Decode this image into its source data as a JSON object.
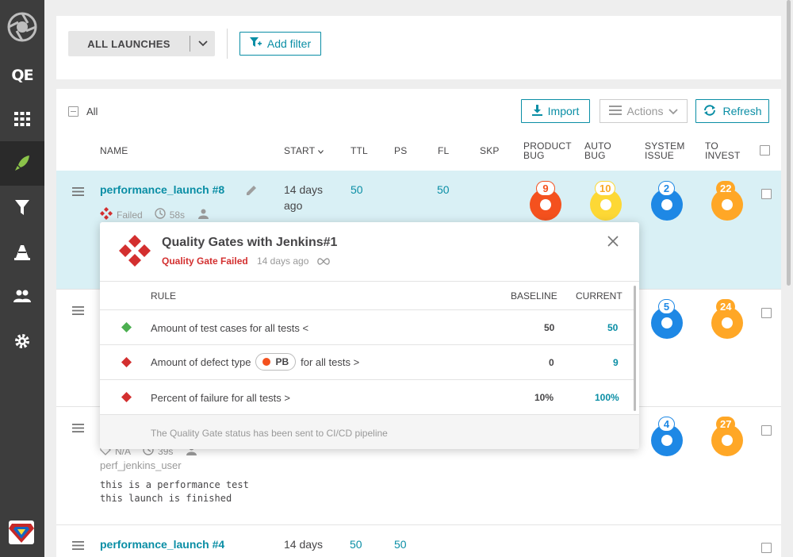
{
  "sidebar": {
    "logo": "aperture-logo-icon",
    "project_label": "QE",
    "items": [
      "dashboard-icon",
      "launches-icon",
      "filters-icon",
      "debug-icon",
      "members-icon",
      "settings-icon"
    ],
    "active": "launches-icon",
    "user_avatar": "superman-avatar"
  },
  "toolbar": {
    "launches_select": "ALL LAUNCHES",
    "add_filter": "Add filter"
  },
  "actions": {
    "all_label": "All",
    "import": "Import",
    "actions": "Actions",
    "refresh": "Refresh"
  },
  "columns": {
    "name": "NAME",
    "start": "START",
    "ttl": "TTL",
    "ps": "PS",
    "fl": "FL",
    "skp": "SKP",
    "product_bug_1": "PRODUCT",
    "product_bug_2": "BUG",
    "auto_bug_1": "AUTO",
    "auto_bug_2": "BUG",
    "system_issue_1": "SYSTEM",
    "system_issue_2": "ISSUE",
    "to_invest_1": "TO",
    "to_invest_2": "INVEST"
  },
  "rows": [
    {
      "name": "performance_launch #8",
      "start_1": "14 days",
      "start_2": "ago",
      "ttl": "50",
      "fl": "50",
      "status": "Failed",
      "duration": "58s",
      "pb": "9",
      "ab": "10",
      "si": "2",
      "ti": "22"
    },
    {
      "si": "5",
      "ti": "24"
    },
    {
      "tag": "N/A",
      "duration": "39s",
      "owner": "perf_jenkins_user",
      "desc_1": "this is a performance test",
      "desc_2": "this launch is finished",
      "si": "4",
      "ti": "27"
    },
    {
      "name": "performance_launch #4",
      "start_1": "14 days",
      "ttl": "50",
      "ps": "50"
    }
  ],
  "popup": {
    "title": "Quality Gates with Jenkins#1",
    "status": "Quality Gate Failed",
    "time": "14 days ago",
    "headers": {
      "rule": "RULE",
      "baseline": "BASELINE",
      "current": "CURRENT"
    },
    "rules": [
      {
        "status": "passed",
        "text": "Amount of test cases for all tests <",
        "baseline": "50",
        "current": "50"
      },
      {
        "status": "failed",
        "text_pre": "Amount of defect type",
        "chip": "PB",
        "text_post": "for all tests >",
        "baseline": "0",
        "current": "9"
      },
      {
        "status": "failed",
        "text": "Percent of failure for all tests >",
        "baseline": "10%",
        "current": "100%"
      }
    ],
    "footer": "The Quality Gate status has been sent to CI/CD pipeline"
  },
  "colors": {
    "accent": "#0a8ea5",
    "product_bug": "#f4511e",
    "auto_bug": "#fdd835",
    "system_issue": "#1e88e5",
    "to_invest": "#ffa726",
    "failed": "#d32f2f",
    "passed": "#4caf50"
  }
}
